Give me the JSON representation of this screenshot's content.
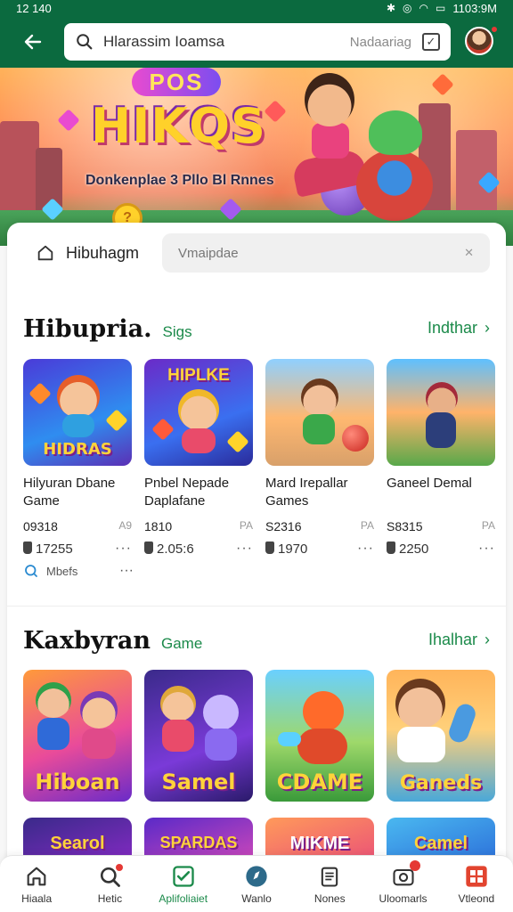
{
  "status_bar": {
    "time": "12 140",
    "right_time": "1103:9M"
  },
  "header": {
    "search_text": "Hlarassim Ioamsa",
    "search_hint": "Nadaariag"
  },
  "hero": {
    "badge": "POS",
    "title": "HIKQS",
    "subtitle": "Donkenplae 3 Pllo Bl Rnnes"
  },
  "filter": {
    "label": "Hibuhagm",
    "input_placeholder": "Vmaipdae"
  },
  "section1": {
    "title": "Hibupria.",
    "tag": "Sigs",
    "more": "Indthar",
    "chevron": "›",
    "games": [
      {
        "thumb_text": "HIDRAS",
        "name": "Hilyuran Dbane Game",
        "code": "09318",
        "side": "A9",
        "score": "17255"
      },
      {
        "thumb_text": "HIPLKE",
        "name": "Pnbel Nepade Daplafane",
        "code": "1810",
        "side": "PA",
        "score": "2.05:6"
      },
      {
        "thumb_text": "",
        "name": "Mard Irepallar Games",
        "code": "S2316",
        "side": "PA",
        "score": "1970"
      },
      {
        "thumb_text": "",
        "name": "Ganeel Demal",
        "code": "S8315",
        "side": "PA",
        "score": "2250"
      }
    ],
    "hint": "Mbefs"
  },
  "section2": {
    "title": "Kaxbyran",
    "tag": "Game",
    "more": "Ihalhar",
    "chevron": "›",
    "games": [
      {
        "thumb_text": "Hiboan"
      },
      {
        "thumb_text": "Samel"
      },
      {
        "thumb_text": "CDAME"
      },
      {
        "thumb_text": "Ganeds"
      }
    ],
    "partial": [
      {
        "thumb_text": "Searol"
      },
      {
        "thumb_text": "SPARDAS"
      },
      {
        "thumb_text": "MIKME"
      },
      {
        "thumb_text": "Camel"
      }
    ]
  },
  "bottom_nav": [
    {
      "label": "Hiaala",
      "icon": "home-icon"
    },
    {
      "label": "Hetic",
      "icon": "search-icon"
    },
    {
      "label": "Aplifoliaiet",
      "icon": "check-square-icon",
      "active": true
    },
    {
      "label": "Wanlo",
      "icon": "compass-icon"
    },
    {
      "label": "Nones",
      "icon": "clipboard-icon"
    },
    {
      "label": "Uloomarls",
      "icon": "camera-icon"
    },
    {
      "label": "Vtleond",
      "icon": "grid-icon"
    }
  ],
  "colors": {
    "brand_green": "#0b6a3f",
    "accent_green": "#1b8a4a",
    "badge_red": "#e53935"
  }
}
